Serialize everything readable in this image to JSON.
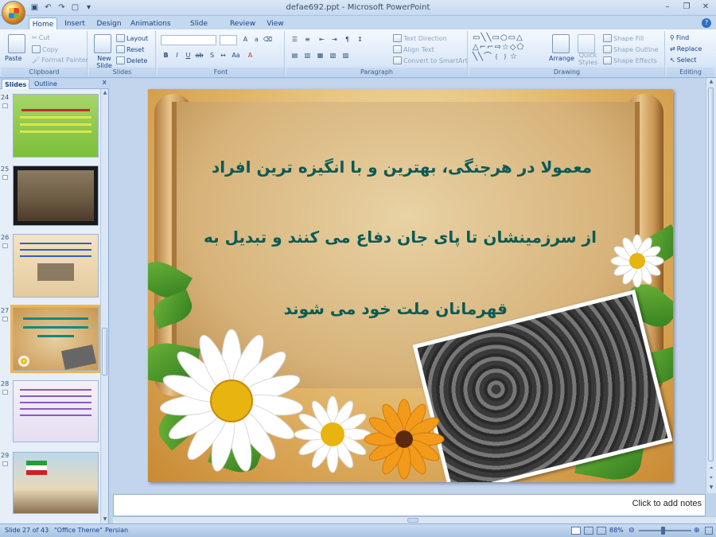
{
  "window": {
    "title": "defae692.ppt - Microsoft PowerPoint",
    "controls": [
      "–",
      "❐",
      "✕"
    ]
  },
  "tabs": [
    "Home",
    "Insert",
    "Design",
    "Animations",
    "Slide Show",
    "Review",
    "View"
  ],
  "ribbon": {
    "clipboard": {
      "label": "Clipboard",
      "paste": "Paste",
      "cut": "Cut",
      "copy": "Copy",
      "format_painter": "Format Painter"
    },
    "slides": {
      "label": "Slides",
      "new_slide": "New Slide",
      "layout": "Layout",
      "reset": "Reset",
      "delete": "Delete"
    },
    "font": {
      "label": "Font"
    },
    "paragraph": {
      "label": "Paragraph",
      "text_direction": "Text Direction",
      "align_text": "Align Text",
      "convert_smartart": "Convert to SmartArt"
    },
    "drawing": {
      "label": "Drawing",
      "arrange": "Arrange",
      "quick_styles": "Quick Styles",
      "shape_fill": "Shape Fill",
      "shape_outline": "Shape Outline",
      "shape_effects": "Shape Effects"
    },
    "editing": {
      "label": "Editing",
      "find": "Find",
      "replace": "Replace",
      "select": "Select"
    }
  },
  "pane": {
    "tab_slides": "Slides",
    "tab_outline": "Outline",
    "close": "x",
    "thumbnails": [
      {
        "num": "24",
        "selected": false
      },
      {
        "num": "25",
        "selected": false
      },
      {
        "num": "26",
        "selected": false
      },
      {
        "num": "27",
        "selected": true
      },
      {
        "num": "28",
        "selected": false
      },
      {
        "num": "29",
        "selected": false
      }
    ]
  },
  "slide": {
    "line1": "معمولا در هرجنگی، بهترین و با انگیزه ترین افراد",
    "line2": "از سرزمینشان تا پای جان دفاع می کنند و تبدیل به",
    "line3": "قهرمانان ملت خود می شوند",
    "text_color": "#0b5a55"
  },
  "notes": {
    "placeholder": "Click to add notes"
  },
  "status": {
    "slide": "Slide 27 of 43",
    "theme": "\"Office Theme\"",
    "language": "Persian",
    "zoom": "88%",
    "zoom_fraction": 0.45
  }
}
